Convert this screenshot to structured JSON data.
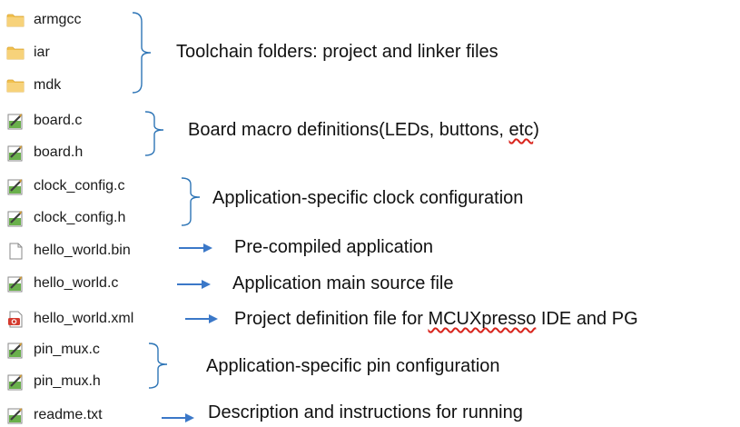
{
  "files": [
    {
      "name": "armgcc",
      "icon": "folder-icon"
    },
    {
      "name": "iar",
      "icon": "folder-icon"
    },
    {
      "name": "mdk",
      "icon": "folder-icon"
    },
    {
      "name": "board.c",
      "icon": "source-file-icon"
    },
    {
      "name": "board.h",
      "icon": "source-file-icon"
    },
    {
      "name": "clock_config.c",
      "icon": "source-file-icon"
    },
    {
      "name": "clock_config.h",
      "icon": "source-file-icon"
    },
    {
      "name": "hello_world.bin",
      "icon": "blank-file-icon"
    },
    {
      "name": "hello_world.c",
      "icon": "source-file-icon"
    },
    {
      "name": "hello_world.xml",
      "icon": "xml-file-icon"
    },
    {
      "name": "pin_mux.c",
      "icon": "source-file-icon"
    },
    {
      "name": "pin_mux.h",
      "icon": "source-file-icon"
    },
    {
      "name": "readme.txt",
      "icon": "source-file-icon"
    }
  ],
  "annotations": {
    "toolchain": "Toolchain folders: project and linker files",
    "board": "Board macro definitions(LEDs, buttons, ",
    "board_etc": "etc",
    "board_close": ")",
    "clock": "Application-specific clock configuration",
    "bin": "Pre-compiled application",
    "source": "Application main source file",
    "xml_prefix": "Project definition file for ",
    "xml_ide": "MCUXpresso",
    "xml_suffix": " IDE and PG",
    "pinmux": "Application-specific pin configuration",
    "readme": "Description and instructions for running"
  },
  "colors": {
    "accent": "#2e75b6",
    "folder": "#f2c14e",
    "spellcheck": "#d9241c"
  }
}
